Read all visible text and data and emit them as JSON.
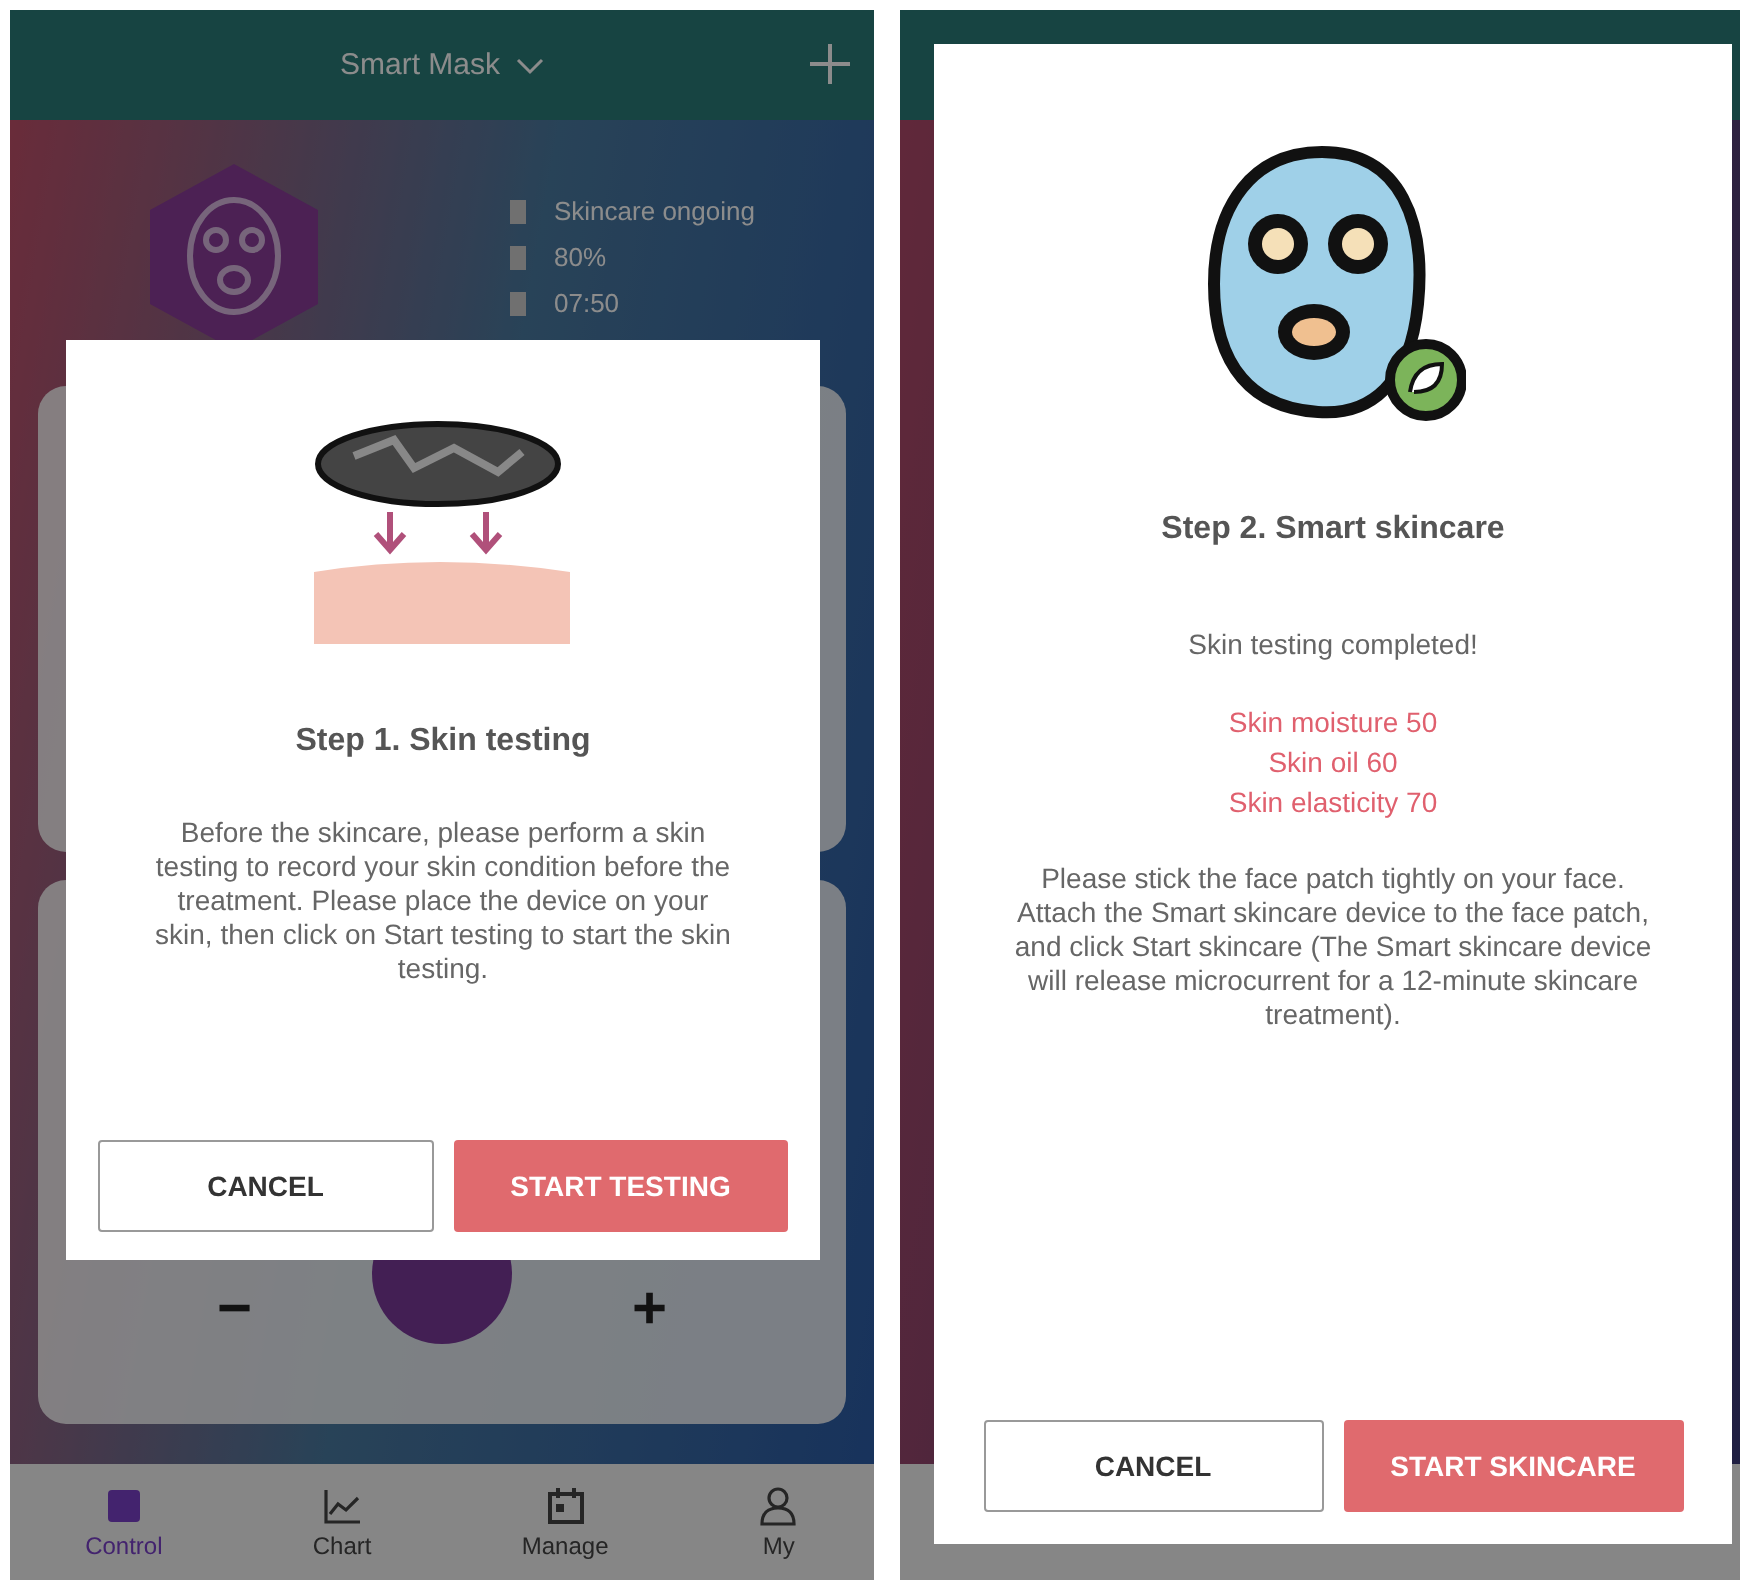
{
  "screens": [
    {
      "app_bar": {
        "title": "Smart Mask"
      },
      "status": [
        "Skincare ongoing",
        "80%",
        "07:50"
      ],
      "adjust": {
        "minus": "−",
        "plus": "+"
      },
      "nav": [
        {
          "label": "Control",
          "selected": true
        },
        {
          "label": "Chart",
          "selected": false
        },
        {
          "label": "Manage",
          "selected": false
        },
        {
          "label": "My",
          "selected": false
        }
      ],
      "dialog": {
        "kind": "device",
        "title": "Step 1. Skin testing",
        "body": "Before the skincare, please perform a skin testing to record your skin condition before the treatment. Please place the device on your skin, then click on Start testing to start the skin testing.",
        "cancel": "CANCEL",
        "confirm": "START TESTING"
      }
    },
    {
      "dialog": {
        "kind": "mask",
        "title": "Step 2. Smart skincare",
        "intro": "Skin testing completed!",
        "readings": [
          "Skin moisture 50",
          "Skin oil 60",
          "Skin elasticity 70"
        ],
        "body": "Please stick the face patch tightly on your face. Attach the Smart skincare device to the face patch, and click Start skincare (The Smart skincare device will release microcurrent for a 12-minute skincare treatment).",
        "cancel": "CANCEL",
        "confirm": "START SKINCARE"
      }
    }
  ]
}
